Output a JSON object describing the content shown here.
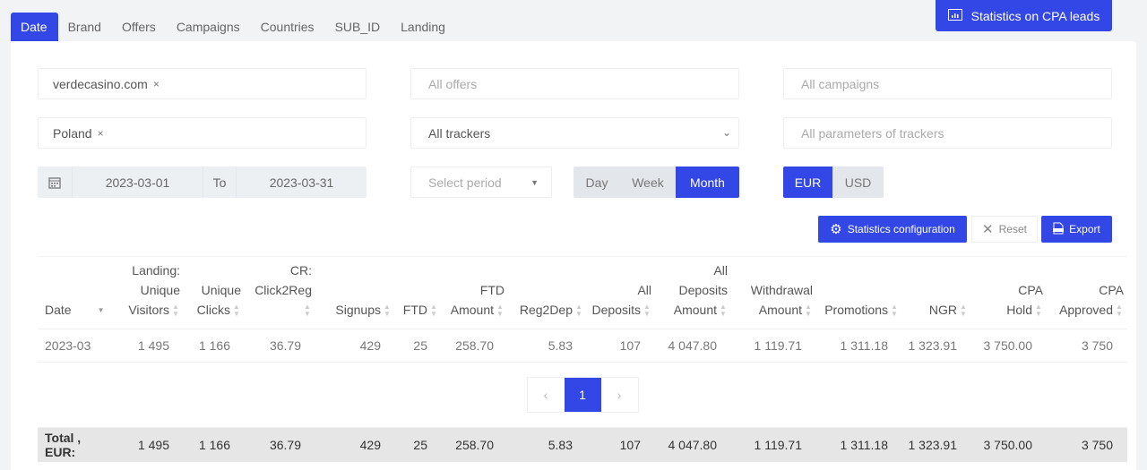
{
  "tabs": [
    "Date",
    "Brand",
    "Offers",
    "Campaigns",
    "Countries",
    "SUB_ID",
    "Landing"
  ],
  "cpa_button": "Statistics on CPA leads",
  "filters": {
    "brand": "verdecasino.com",
    "offers_placeholder": "All offers",
    "campaigns_placeholder": "All campaigns",
    "country": "Poland",
    "trackers": "All trackers",
    "tracker_params_placeholder": "All parameters of trackers",
    "date_from": "2023-03-01",
    "date_to_label": "To",
    "date_to": "2023-03-31",
    "period_placeholder": "Select period",
    "remove": "×"
  },
  "granularity": {
    "options": [
      "Day",
      "Week",
      "Month"
    ],
    "selected": "Month"
  },
  "currency": {
    "options": [
      "EUR",
      "USD"
    ],
    "selected": "EUR"
  },
  "actions": {
    "config": "Statistics configuration",
    "reset": "Reset",
    "export": "Export"
  },
  "table": {
    "headers": [
      [
        "Date"
      ],
      [
        "Landing:",
        "Unique",
        "Visitors"
      ],
      [
        "Unique",
        "Clicks"
      ],
      [
        "CR:",
        "Click2Reg"
      ],
      [
        "Signups"
      ],
      [
        "FTD"
      ],
      [
        "FTD",
        "Amount"
      ],
      [
        "Reg2Dep"
      ],
      [
        "All",
        "Deposits"
      ],
      [
        "All",
        "Deposits",
        "Amount"
      ],
      [
        "Withdrawal",
        "Amount"
      ],
      [
        "Promotions"
      ],
      [
        "NGR"
      ],
      [
        "CPA",
        "Hold"
      ],
      [
        "CPA",
        "Approved"
      ]
    ],
    "rows": [
      [
        "2023-03",
        "1 495",
        "1 166",
        "36.79",
        "429",
        "25",
        "258.70",
        "5.83",
        "107",
        "4 047.80",
        "1 119.71",
        "1 311.18",
        "1 323.91",
        "3 750.00",
        "3 750"
      ]
    ],
    "total": [
      "Total , EUR:",
      "1 495",
      "1 166",
      "36.79",
      "429",
      "25",
      "258.70",
      "5.83",
      "107",
      "4 047.80",
      "1 119.71",
      "1 311.18",
      "1 323.91",
      "3 750.00",
      "3 750"
    ]
  },
  "pagination": {
    "prev": "‹",
    "current": "1",
    "next": "›"
  },
  "colors": {
    "accent": "#3346e6"
  }
}
